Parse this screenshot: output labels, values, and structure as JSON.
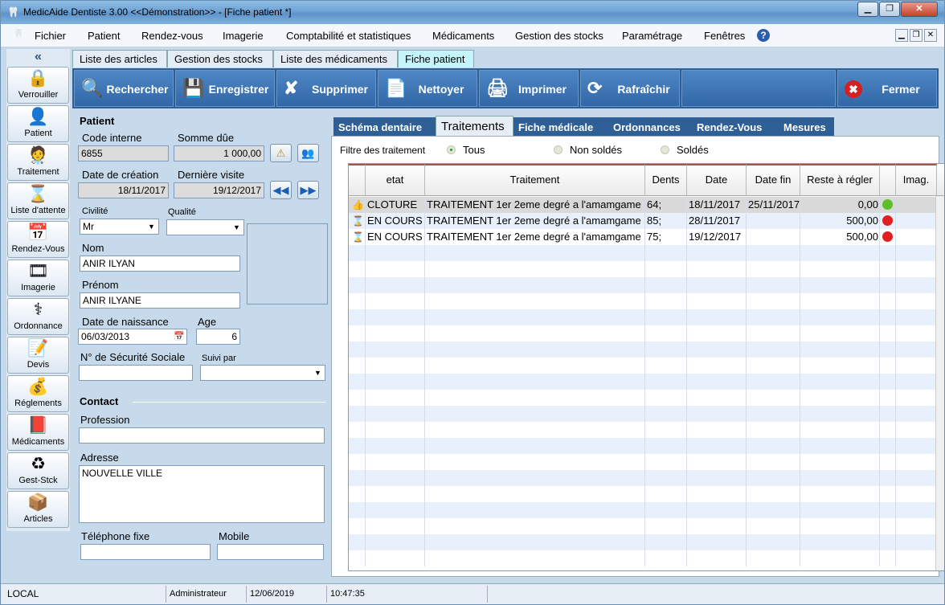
{
  "window": {
    "title": "MedicAide Dentiste 3.00 <<Démonstration>>  - [Fiche patient *]",
    "min": "▁",
    "max": "❐",
    "close": "✕"
  },
  "menu": {
    "items": [
      "Fichier",
      "Patient",
      "Rendez-vous",
      "Imagerie",
      "Comptabilité et statistiques",
      "Médicaments",
      "Gestion des stocks",
      "Paramétrage",
      "Fenêtres"
    ],
    "help": "?",
    "mdi": [
      "▁",
      "❐",
      "✕"
    ]
  },
  "sidebar": {
    "collapse": "«",
    "items": [
      {
        "label": "Verrouiller",
        "icon": "lock-icon",
        "glyph": "🔒"
      },
      {
        "label": "Patient",
        "icon": "patient-icon",
        "glyph": "👤"
      },
      {
        "label": "Traitement",
        "icon": "doctor-icon",
        "glyph": "🧑‍⚕️"
      },
      {
        "label": "Liste d'attente",
        "icon": "hourglass-icon",
        "glyph": "⌛"
      },
      {
        "label": "Rendez-Vous",
        "icon": "calendar-clock-icon",
        "glyph": "📅"
      },
      {
        "label": "Imagerie",
        "icon": "film-icon",
        "glyph": "🎞"
      },
      {
        "label": "Ordonnance",
        "icon": "caduceus-icon",
        "glyph": "⚕"
      },
      {
        "label": "Devis",
        "icon": "document-pen-icon",
        "glyph": "📝"
      },
      {
        "label": "Réglements",
        "icon": "money-icon",
        "glyph": "💰"
      },
      {
        "label": "Médicaments",
        "icon": "book-icon",
        "glyph": "📕"
      },
      {
        "label": "Gest-Stck",
        "icon": "recycle-icon",
        "glyph": "♻"
      },
      {
        "label": "Articles",
        "icon": "box-icon",
        "glyph": "📦"
      }
    ]
  },
  "doc_tabs": [
    "Liste des articles",
    "Gestion des stocks",
    "Liste des médicaments",
    "Fiche patient"
  ],
  "toolbar": {
    "buttons": [
      {
        "label": "Rechercher",
        "icon": "search-icon",
        "glyph": "🔍"
      },
      {
        "label": "Enregistrer",
        "icon": "save-icon",
        "glyph": "💾"
      },
      {
        "label": "Supprimer",
        "icon": "delete-icon",
        "glyph": "✘"
      },
      {
        "label": "Nettoyer",
        "icon": "blank-page-icon",
        "glyph": "📄"
      },
      {
        "label": "Imprimer",
        "icon": "printer-icon",
        "glyph": "🖨"
      },
      {
        "label": "Rafraîchir",
        "icon": "refresh-icon",
        "glyph": "⟳"
      }
    ],
    "close": {
      "label": "Fermer",
      "icon": "close-icon",
      "glyph": "✖"
    }
  },
  "patient": {
    "section": "Patient",
    "code_label": "Code interne",
    "code": "6855",
    "due_label": "Somme dûe",
    "due": "1 000,00",
    "created_label": "Date de création",
    "created": "18/11/2017",
    "last_visit_label": "Dernière visite",
    "last_visit": "19/12/2017",
    "civility_label": "Civilité",
    "civility": "Mr",
    "quality_label": "Qualité",
    "quality": "",
    "nom_label": "Nom",
    "nom": "ANIR ILYAN",
    "prenom_label": "Prénom",
    "prenom": "ANIR ILYANE",
    "birth_label": "Date de naissance",
    "birth": "06/03/2013",
    "age_label": "Age",
    "age": "6",
    "ssn_label": "N° de Sécurité Sociale",
    "ssn": "",
    "followed_label": "Suivi par",
    "followed": ""
  },
  "contact": {
    "section": "Contact",
    "profession_label": "Profession",
    "profession": "",
    "address_label": "Adresse",
    "address": "NOUVELLE VILLE",
    "phone_label": "Téléphone fixe",
    "phone": "",
    "mobile_label": "Mobile",
    "mobile": ""
  },
  "detail_tabs": [
    "Schéma dentaire",
    "Traitements",
    "Fiche médicale",
    "Ordonnances",
    "Rendez-Vous",
    "Mesures"
  ],
  "filter": {
    "label": "Filtre des traitement",
    "options": [
      "Tous",
      "Non soldés",
      "Soldés"
    ],
    "selected": "Tous"
  },
  "table": {
    "columns": [
      "etat",
      "Traitement",
      "Dents",
      "Date",
      "Date fin",
      "Reste à régler",
      "",
      "Imag."
    ],
    "rows": [
      {
        "etat": "CLOTURE",
        "traitement": "TRAITEMENT 1er 2eme degré  a l'amamgame",
        "dents": "64;",
        "date": "18/11/2017",
        "date_fin": "25/11/2017",
        "reste": "0,00",
        "status_color": "#5cbf2a"
      },
      {
        "etat": "EN COURS",
        "traitement": "TRAITEMENT 1er 2eme degré  a l'amamgame",
        "dents": "85;",
        "date": "28/11/2017",
        "date_fin": "",
        "reste": "500,00",
        "status_color": "#e02020"
      },
      {
        "etat": "EN COURS",
        "traitement": "TRAITEMENT 1er 2eme degré  a l'amamgame",
        "dents": "75;",
        "date": "19/12/2017",
        "date_fin": "",
        "reste": "500,00",
        "status_color": "#e02020"
      }
    ]
  },
  "status": {
    "location": "LOCAL",
    "user": "Administrateur",
    "date": "12/06/2019",
    "time": "10:47:35"
  }
}
